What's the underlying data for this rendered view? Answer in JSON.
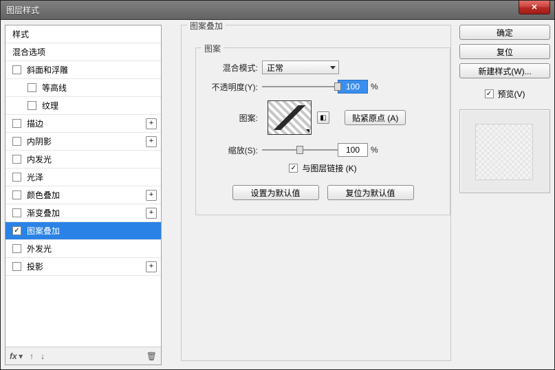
{
  "window": {
    "title": "图层样式"
  },
  "sidebar": {
    "header_styles": "样式",
    "header_blend": "混合选项",
    "items": [
      {
        "label": "斜面和浮雕",
        "checked": false,
        "plus": false,
        "indent": 0,
        "selected": false
      },
      {
        "label": "等高线",
        "checked": false,
        "plus": false,
        "indent": 1,
        "selected": false
      },
      {
        "label": "纹理",
        "checked": false,
        "plus": false,
        "indent": 1,
        "selected": false
      },
      {
        "label": "描边",
        "checked": false,
        "plus": true,
        "indent": 0,
        "selected": false
      },
      {
        "label": "内阴影",
        "checked": false,
        "plus": true,
        "indent": 0,
        "selected": false
      },
      {
        "label": "内发光",
        "checked": false,
        "plus": false,
        "indent": 0,
        "selected": false
      },
      {
        "label": "光泽",
        "checked": false,
        "plus": false,
        "indent": 0,
        "selected": false
      },
      {
        "label": "颜色叠加",
        "checked": false,
        "plus": true,
        "indent": 0,
        "selected": false
      },
      {
        "label": "渐变叠加",
        "checked": false,
        "plus": true,
        "indent": 0,
        "selected": false
      },
      {
        "label": "图案叠加",
        "checked": true,
        "plus": false,
        "indent": 0,
        "selected": true
      },
      {
        "label": "外发光",
        "checked": false,
        "plus": false,
        "indent": 0,
        "selected": false
      },
      {
        "label": "投影",
        "checked": false,
        "plus": true,
        "indent": 0,
        "selected": false
      }
    ],
    "footer": {
      "fx": "fx",
      "up": "↑",
      "down": "↓",
      "trash": "🗑"
    }
  },
  "panel": {
    "outer_title": "图案叠加",
    "inner_title": "图案",
    "blend_label": "混合模式:",
    "blend_value": "正常",
    "opacity_label": "不透明度(Y):",
    "opacity_value": "100",
    "opacity_unit": "%",
    "pattern_label": "图案:",
    "snap_origin": "贴紧原点 (A)",
    "scale_label": "缩放(S):",
    "scale_value": "100",
    "scale_unit": "%",
    "link_label": "与图层链接 (K)",
    "set_default": "设置为默认值",
    "reset_default": "复位为默认值"
  },
  "right": {
    "ok": "确定",
    "reset": "复位",
    "new_style": "新建样式(W)...",
    "preview": "预览(V)"
  }
}
